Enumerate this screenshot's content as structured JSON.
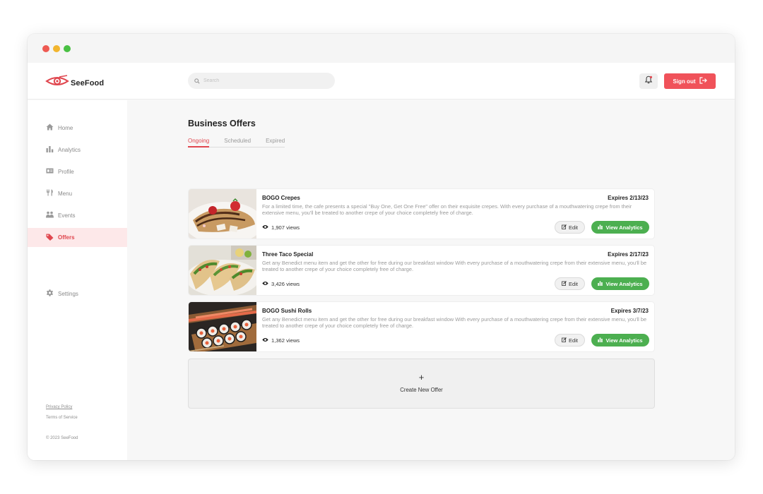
{
  "app": {
    "name": "SeeFood"
  },
  "colors": {
    "accent": "#f0525a",
    "success": "#4caf50",
    "active_bg": "#fde8e9"
  },
  "search": {
    "placeholder": "Search"
  },
  "header": {
    "signout_label": "Sign out"
  },
  "sidebar": {
    "items": [
      {
        "label": "Home",
        "icon": "home-icon"
      },
      {
        "label": "Analytics",
        "icon": "bar-chart-icon"
      },
      {
        "label": "Profile",
        "icon": "id-card-icon"
      },
      {
        "label": "Menu",
        "icon": "utensils-icon"
      },
      {
        "label": "Events",
        "icon": "people-icon"
      },
      {
        "label": "Offers",
        "icon": "tag-icon",
        "active": true
      },
      {
        "label": "Settings",
        "icon": "gear-icon"
      }
    ],
    "footer": {
      "privacy": "Privacy Policy",
      "terms": "Terms of Service",
      "copyright": "© 2023 SeeFood"
    }
  },
  "main": {
    "title": "Business Offers",
    "tabs": [
      {
        "label": "Ongoing",
        "active": true
      },
      {
        "label": "Scheduled"
      },
      {
        "label": "Expired"
      }
    ],
    "offers": [
      {
        "title": "BOGO Crepes",
        "expires": "Expires 2/13/23",
        "description": "For a limited time, the cafe presents a special \"Buy One, Get One Free\" offer on their exquisite crepes. With every purchase of a mouthwatering crepe from their extensive menu, you'll be treated to another crepe of your choice completely free of charge.",
        "views": "1,907 views",
        "image": "crepes-photo"
      },
      {
        "title": "Three Taco Special",
        "expires": "Expires 2/17/23",
        "description": "Get any Benedict menu item and get the other for free during our breakfast window With every purchase of a mouthwatering crepe from their extensive menu, you'll be treated to another crepe of your choice completely free of charge.",
        "views": "3,426 views",
        "image": "tacos-photo"
      },
      {
        "title": "BOGO Sushi Rolls",
        "expires": "Expires 3/7/23",
        "description": "Get any Benedict menu item and get the other for free during our breakfast window With every purchase of a mouthwatering crepe from their extensive menu, you'll be treated to another crepe of your choice completely free of charge.",
        "views": "1,362 views",
        "image": "sushi-photo"
      }
    ],
    "edit_label": "Edit",
    "analytics_label": "View Analytics",
    "create_plus": "+",
    "create_label": "Create New Offer"
  }
}
